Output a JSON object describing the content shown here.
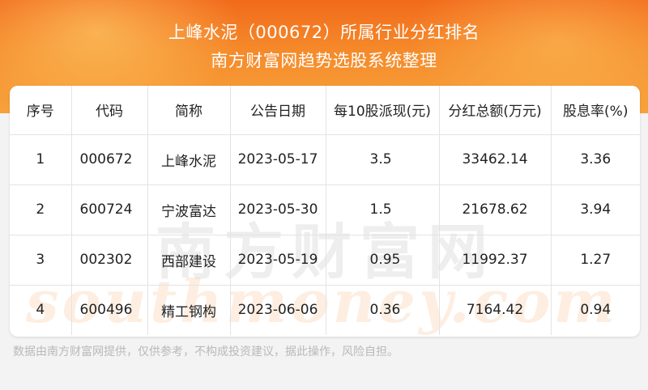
{
  "header": {
    "title": "上峰水泥（000672）所属行业分红排名",
    "subtitle": "南方财富网趋势选股系统整理"
  },
  "table": {
    "columns": [
      "序号",
      "代码",
      "简称",
      "公告日期",
      "每10股派现(元)",
      "分红总额(万元)",
      "股息率(%)"
    ],
    "rows": [
      {
        "rank": "1",
        "code": "000672",
        "name": "上峰水泥",
        "date": "2023-05-17",
        "dividend": "3.5",
        "total": "33462.14",
        "yield": "3.36"
      },
      {
        "rank": "2",
        "code": "600724",
        "name": "宁波富达",
        "date": "2023-05-30",
        "dividend": "1.5",
        "total": "21678.62",
        "yield": "3.94"
      },
      {
        "rank": "3",
        "code": "002302",
        "name": "西部建设",
        "date": "2023-05-19",
        "dividend": "0.95",
        "total": "11992.37",
        "yield": "1.27"
      },
      {
        "rank": "4",
        "code": "600496",
        "name": "精工钢构",
        "date": "2023-06-06",
        "dividend": "0.36",
        "total": "7164.42",
        "yield": "0.94"
      }
    ]
  },
  "watermark": {
    "cn": "南方财富网",
    "en": "southmoney.com"
  },
  "footer": {
    "disclaimer": "数据由南方财富网提供，仅供参考，不构成投资建议，据此操作，风险自担。"
  },
  "colors": {
    "header_top": "#f26a1b",
    "header_bottom": "#f7a23c",
    "text": "#222222",
    "footer_text": "#b9b9b9"
  }
}
